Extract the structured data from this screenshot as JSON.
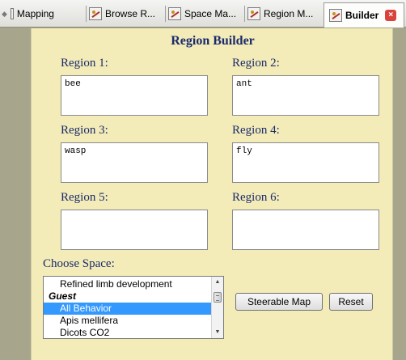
{
  "tabs": [
    {
      "label": "Mapping"
    },
    {
      "label": "Browse R..."
    },
    {
      "label": "Space Ma..."
    },
    {
      "label": "Region M..."
    },
    {
      "label": "Builder"
    }
  ],
  "panel": {
    "title": "Region Builder",
    "regions": [
      {
        "label": "Region 1:",
        "value": "bee"
      },
      {
        "label": "Region 2:",
        "value": "ant"
      },
      {
        "label": "Region 3:",
        "value": "wasp"
      },
      {
        "label": "Region 4:",
        "value": "fly"
      },
      {
        "label": "Region 5:",
        "value": ""
      },
      {
        "label": "Region 6:",
        "value": ""
      }
    ],
    "choose_space_label": "Choose Space:",
    "space_list": [
      {
        "text": "Refined limb development",
        "kind": "item"
      },
      {
        "text": "Guest",
        "kind": "group"
      },
      {
        "text": "All Behavior",
        "kind": "selected"
      },
      {
        "text": "Apis mellifera",
        "kind": "item"
      },
      {
        "text": "Dicots CO2",
        "kind": "item"
      }
    ],
    "steerable_map_label": "Steerable Map",
    "reset_label": "Reset"
  },
  "colors": {
    "panel_bg": "#f3ecb8",
    "heading": "#1a2a6c",
    "selection": "#3399ff",
    "close": "#d8443c"
  }
}
